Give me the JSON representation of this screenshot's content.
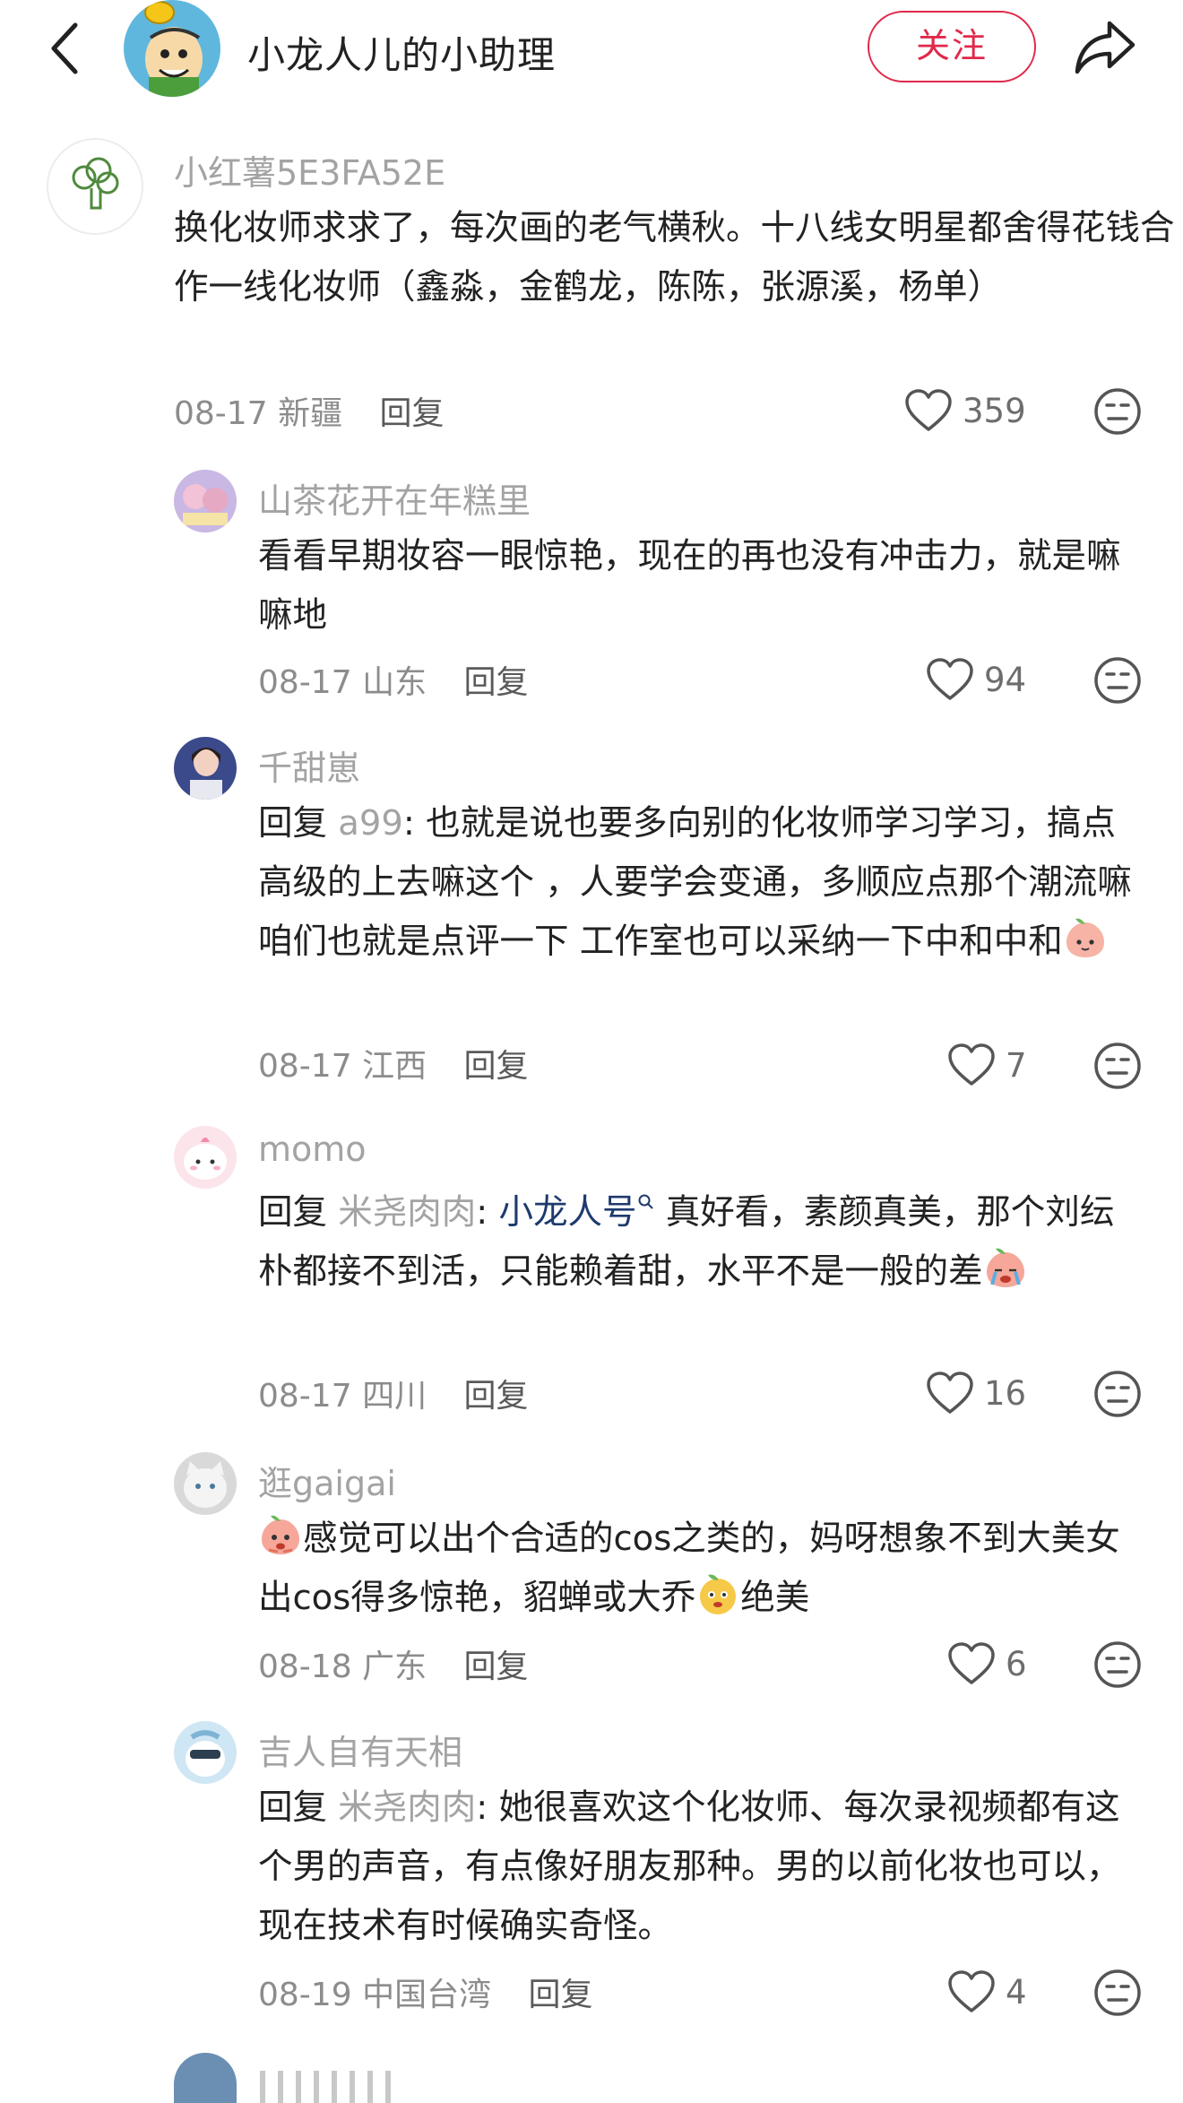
{
  "header": {
    "author_name": "小龙人儿的小助理",
    "follow_label": "关注"
  },
  "icons": {
    "back": "chevron-left-icon",
    "share": "share-arrow-icon",
    "like": "heart-outline-icon",
    "dislike": "meh-face-icon"
  },
  "colors": {
    "accent": "#e0294b",
    "username": "#a3a3a3",
    "link": "#1e3a6e"
  },
  "comments": [
    {
      "user": "小红薯5E3FA52E",
      "text": "换化妆师求求了，每次画的老气横秋。十八线女明星都舍得花钱合作一线化妆师（鑫淼，金鹤龙，陈陈，张源溪，杨单）",
      "date": "08-17",
      "location": "新疆",
      "reply_label": "回复",
      "likes": "359"
    },
    {
      "user": "山茶花开在年糕里",
      "text": "看看早期妆容一眼惊艳，现在的再也没有冲击力，就是嘛嘛地",
      "date": "08-17",
      "location": "山东",
      "reply_label": "回复",
      "likes": "94"
    },
    {
      "user": "千甜崽",
      "reply_prefix": "回复 ",
      "reply_to": "a99",
      "text": ": 也就是说也要多向别的化妆师学习学习，搞点高级的上去嘛这个 ，人要学会变通，多顺应点那个潮流嘛 咱们也就是点评一下 工作室也可以采纳一下中和中和",
      "date": "08-17",
      "location": "江西",
      "reply_label": "回复",
      "likes": "7"
    },
    {
      "user": "momo",
      "reply_prefix": "回复 ",
      "reply_to": "米尧肉肉",
      "sep": ": ",
      "link_text": "小龙人号",
      "text": " 真好看，素颜真美，那个刘纭朴都接不到活，只能赖着甜，水平不是一般的差",
      "date": "08-17",
      "location": "四川",
      "reply_label": "回复",
      "likes": "16"
    },
    {
      "user": "逛gaigai",
      "text_a": "感觉可以出个合适的cos之类的，妈呀想象不到大美女出cos得多惊艳，貂蝉或大乔",
      "text_b": "绝美",
      "date": "08-18",
      "location": "广东",
      "reply_label": "回复",
      "likes": "6"
    },
    {
      "user": "吉人自有天相",
      "reply_prefix": "回复 ",
      "reply_to": "米尧肉肉",
      "text": ": 她很喜欢这个化妆师、每次录视频都有这个男的声音，有点像好朋友那种。男的以前化妆也可以，现在技术有时候确实奇怪。",
      "date": "08-19",
      "location": "中国台湾",
      "reply_label": "回复",
      "likes": "4"
    }
  ]
}
